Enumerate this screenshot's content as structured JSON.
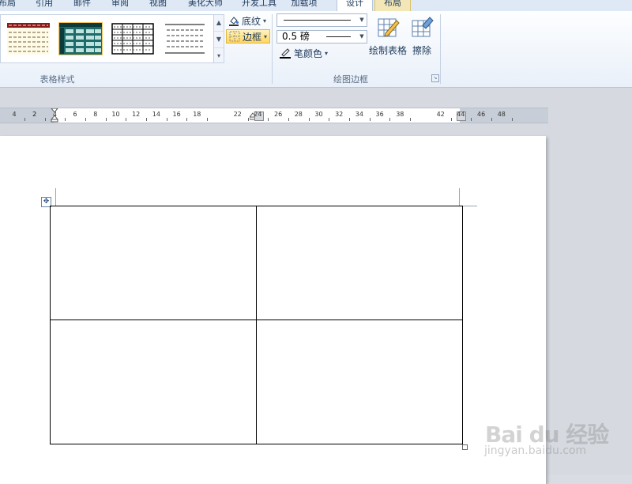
{
  "tabs": [
    {
      "label": "布局",
      "state": "normal"
    },
    {
      "label": "引用",
      "state": "normal"
    },
    {
      "label": "邮件",
      "state": "normal"
    },
    {
      "label": "审阅",
      "state": "normal"
    },
    {
      "label": "视图",
      "state": "normal"
    },
    {
      "label": "美化大师",
      "state": "normal"
    },
    {
      "label": "开发工具",
      "state": "normal"
    },
    {
      "label": "加载项",
      "state": "normal"
    },
    {
      "label": "设计",
      "state": "active"
    },
    {
      "label": "布局",
      "state": "contextual"
    }
  ],
  "ribbon": {
    "table_styles": {
      "group_label": "表格样式",
      "shading_label": "底纹",
      "borders_label": "边框"
    },
    "draw_borders": {
      "group_label": "绘图边框",
      "line_weight": "0.5 磅",
      "pen_color_label": "笔颜色",
      "draw_table_label": "绘制表格",
      "eraser_label": "擦除"
    }
  },
  "ruler": {
    "labels": [
      "4",
      "2",
      "2",
      "4",
      "6",
      "8",
      "10",
      "12",
      "14",
      "16",
      "18",
      "22",
      "24",
      "26",
      "28",
      "30",
      "32",
      "34",
      "36",
      "38",
      "42",
      "44",
      "46",
      "48"
    ]
  },
  "table": {
    "rows": 2,
    "cols": 2
  },
  "watermark": {
    "logo": "Bai du 经验",
    "url": "jingyan.baidu.com"
  },
  "colors": {
    "ribbon_bg": "#e9f0f9",
    "highlight": "#ffd760",
    "document_bg": "#d6dae0",
    "style_header_red": "#8b1a1a",
    "style_teal": "#1f6b6a"
  },
  "icons": [
    "shading-icon",
    "borders-icon",
    "pen-color-icon",
    "draw-table-icon",
    "eraser-icon",
    "table-move-icon",
    "gallery-scroll-up-icon",
    "gallery-scroll-down-icon",
    "gallery-more-icon",
    "dialog-launcher-icon"
  ]
}
